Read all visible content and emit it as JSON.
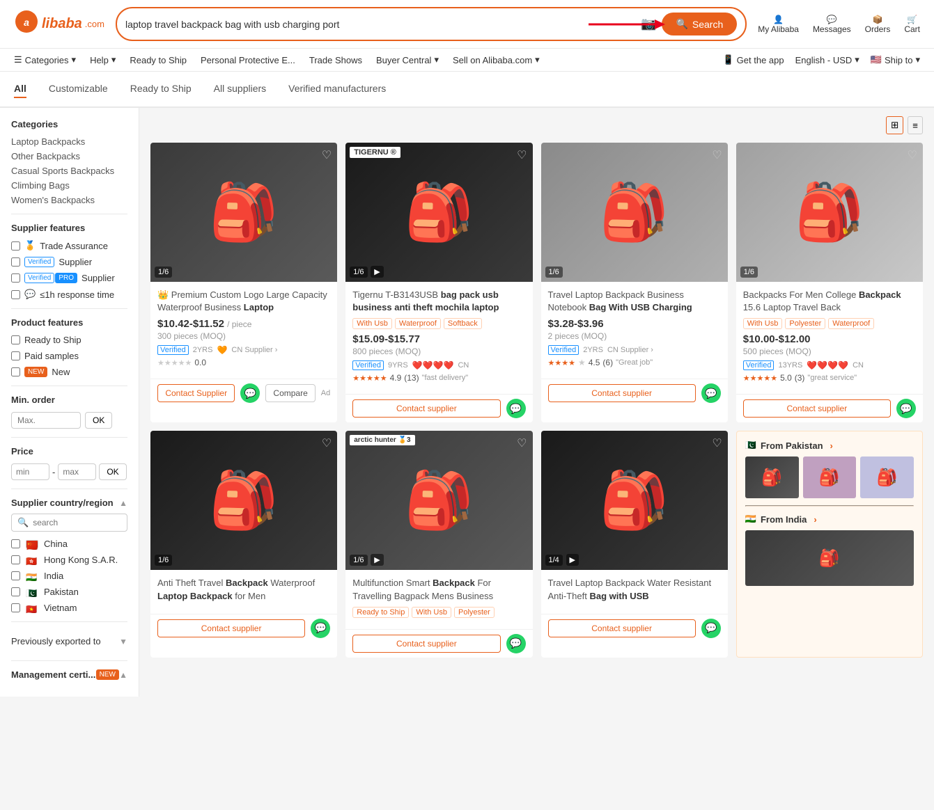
{
  "header": {
    "logo": "alibaba",
    "logo_com": ".com",
    "search_value": "laptop travel backpack bag with usb charging port",
    "search_placeholder": "laptop travel backpack bag with usb charging port",
    "search_label": "Search",
    "actions": [
      {
        "id": "my-alibaba",
        "icon": "👤",
        "label": "My Alibaba"
      },
      {
        "id": "messages",
        "icon": "💬",
        "label": "Messages"
      },
      {
        "id": "orders",
        "icon": "📦",
        "label": "Orders"
      },
      {
        "id": "cart",
        "icon": "🛒",
        "label": "Cart"
      }
    ]
  },
  "nav": {
    "items": [
      {
        "id": "categories",
        "label": "Categories",
        "has_arrow": true
      },
      {
        "id": "help",
        "label": "Help",
        "has_arrow": true
      },
      {
        "id": "ready-to-ship",
        "label": "Ready to Ship"
      },
      {
        "id": "personal-protective",
        "label": "Personal Protective E..."
      },
      {
        "id": "trade-shows",
        "label": "Trade Shows"
      },
      {
        "id": "buyer-central",
        "label": "Buyer Central",
        "has_arrow": true
      },
      {
        "id": "sell-on-alibaba",
        "label": "Sell on Alibaba.com",
        "has_arrow": true
      }
    ],
    "right": [
      {
        "id": "get-app",
        "icon": "📱",
        "label": "Get the app"
      },
      {
        "id": "language",
        "label": "English - USD",
        "has_arrow": true
      },
      {
        "id": "ship-to",
        "label": "Ship to 🇺🇸",
        "has_arrow": true
      }
    ]
  },
  "tabs": [
    {
      "id": "all",
      "label": "All",
      "active": true
    },
    {
      "id": "customizable",
      "label": "Customizable"
    },
    {
      "id": "ready-to-ship",
      "label": "Ready to Ship"
    },
    {
      "id": "all-suppliers",
      "label": "All suppliers"
    },
    {
      "id": "verified-manufacturers",
      "label": "Verified manufacturers"
    }
  ],
  "sidebar": {
    "categories_title": "Categories",
    "categories": [
      {
        "id": "laptop-backpacks",
        "label": "Laptop Backpacks"
      },
      {
        "id": "other-backpacks",
        "label": "Other Backpacks"
      },
      {
        "id": "casual-sports",
        "label": "Casual Sports Backpacks"
      },
      {
        "id": "climbing-bags",
        "label": "Climbing Bags"
      },
      {
        "id": "womens-backpacks",
        "label": "Women's Backpacks"
      }
    ],
    "supplier_features_title": "Supplier features",
    "supplier_features": [
      {
        "id": "trade-assurance",
        "label": "Trade Assurance",
        "badge": "🏅"
      },
      {
        "id": "verified-supplier",
        "label": "Supplier",
        "badge": "Verified",
        "badge_type": "blue"
      },
      {
        "id": "verified-pro-supplier",
        "label": "Supplier",
        "badge": "Verified PRO",
        "badge_type": "pro"
      },
      {
        "id": "response-time",
        "label": "≤1h response time",
        "badge": "💬"
      }
    ],
    "product_features_title": "Product features",
    "product_features": [
      {
        "id": "ready-to-ship",
        "label": "Ready to Ship"
      },
      {
        "id": "paid-samples",
        "label": "Paid samples"
      },
      {
        "id": "new-items",
        "label": "New",
        "badge": "NEW",
        "badge_type": "new"
      }
    ],
    "min_order_title": "Min. order",
    "min_order_placeholder": "Max.",
    "min_order_ok": "OK",
    "price_title": "Price",
    "price_min": "min",
    "price_max": "max",
    "price_ok": "OK",
    "supplier_country_title": "Supplier country/region",
    "country_search_placeholder": "search",
    "countries": [
      {
        "id": "china",
        "label": "China",
        "flag": "cn"
      },
      {
        "id": "hong-kong",
        "label": "Hong Kong S.A.R.",
        "flag": "hk"
      },
      {
        "id": "india",
        "label": "India",
        "flag": "in"
      },
      {
        "id": "pakistan",
        "label": "Pakistan",
        "flag": "pk"
      },
      {
        "id": "vietnam",
        "label": "Vietnam",
        "flag": "vn"
      }
    ],
    "prev_exported_title": "Previously exported to",
    "mgmt_cert_title": "Management certi...",
    "mgmt_cert_badge": "NEW"
  },
  "products": [
    {
      "id": "p1",
      "title_prefix": "Premium Custom Logo Large Capacity Waterproof Business ",
      "title_bold": "Laptop",
      "img_count": "1/6",
      "has_video": false,
      "crown": true,
      "price": "$10.42-$11.52",
      "price_unit": "/ piece",
      "moq": "300 pieces (MOQ)",
      "supplier_badge": "Verified",
      "supplier_years": "2YRS",
      "supplier_heart": "🧡",
      "supplier_country": "CN Supplier",
      "rating": "0.0",
      "rating_stars": 0,
      "rating_count": "",
      "rating_note": "",
      "tags": [],
      "action": "Contact Supplier",
      "has_compare": true,
      "ad": true
    },
    {
      "id": "p2",
      "title_prefix": "Tigernu T-B3143USB ",
      "title_bold": "bag pack usb business anti theft mochila laptop",
      "img_count": "1/6",
      "has_video": true,
      "crown": false,
      "brand": "TIGERNU",
      "price": "$15.09-$15.77",
      "price_unit": "",
      "moq": "800 pieces (MOQ)",
      "supplier_badge": "Verified",
      "supplier_years": "9YRS",
      "supplier_hearts": "❤️❤️❤️❤️",
      "supplier_country": "CN",
      "rating": "4.9",
      "rating_count": "(13)",
      "rating_note": "\"fast delivery\"",
      "tags": [
        "With Usb",
        "Waterproof",
        "Softback"
      ],
      "action": "Contact supplier",
      "has_compare": false,
      "ad": false
    },
    {
      "id": "p3",
      "title_prefix": "Travel Laptop Backpack Business Notebook ",
      "title_bold": "Bag With USB Charging",
      "img_count": "1/6",
      "has_video": false,
      "crown": false,
      "price": "$3.28-$3.96",
      "price_unit": "",
      "moq": "2 pieces (MOQ)",
      "supplier_badge": "Verified",
      "supplier_years": "2YRS",
      "supplier_country": "CN Supplier",
      "rating": "4.5",
      "rating_count": "(6)",
      "rating_note": "\"Great job\"",
      "tags": [],
      "action": "Contact supplier",
      "has_compare": false,
      "ad": false
    },
    {
      "id": "p4",
      "title_prefix": "Backpacks For Men College ",
      "title_bold": "Backpack",
      "title_suffix": " 15.6 Laptop Travel Back",
      "img_count": "1/6",
      "has_video": false,
      "crown": false,
      "price": "$10.00-$12.00",
      "price_unit": "",
      "moq": "500 pieces (MOQ)",
      "supplier_badge": "Verified",
      "supplier_years": "13YRS",
      "supplier_hearts": "❤️❤️❤️❤️",
      "supplier_country": "CN",
      "rating": "5.0",
      "rating_count": "(3)",
      "rating_note": "\"great service\"",
      "tags": [
        "With Usb",
        "Polyester",
        "Waterproof"
      ],
      "action": "Contact supplier",
      "has_compare": false,
      "ad": false
    },
    {
      "id": "p5",
      "title_prefix": "Anti Theft Travel ",
      "title_bold": "Backpack",
      "title_suffix": " Waterproof Laptop Backpack for Men",
      "img_count": "1/6",
      "has_video": false,
      "crown": false,
      "price": "",
      "moq": "",
      "tags": [],
      "action": "Contact supplier",
      "has_compare": false,
      "ad": false
    },
    {
      "id": "p6",
      "title_prefix": "Multifunction Smart ",
      "title_bold": "Backpack",
      "title_suffix": " For Travelling Bagpack Mens Business",
      "img_count": "1/6",
      "has_video": true,
      "crown": false,
      "brand": "arctic hunter",
      "price": "",
      "moq": "",
      "tags": [
        "Ready to Ship",
        "With Usb",
        "Polyester"
      ],
      "action": "Contact supplier",
      "has_compare": false,
      "ad": false
    },
    {
      "id": "p7",
      "title_prefix": "Travel Laptop Backpack Water Resistant Anti-Theft ",
      "title_bold": "Bag with USB",
      "img_count": "1/4",
      "has_video": true,
      "crown": false,
      "price": "",
      "moq": "",
      "tags": [],
      "action": "Contact supplier",
      "has_compare": false,
      "ad": false
    }
  ],
  "from_pakistan": {
    "title": "From Pakistan",
    "arrow": "›",
    "items": [
      "🎒",
      "🎒",
      "🎒"
    ]
  },
  "from_india": {
    "title": "From India",
    "arrow": "›"
  },
  "view_options": {
    "grid_icon": "⊞",
    "list_icon": "≡"
  }
}
